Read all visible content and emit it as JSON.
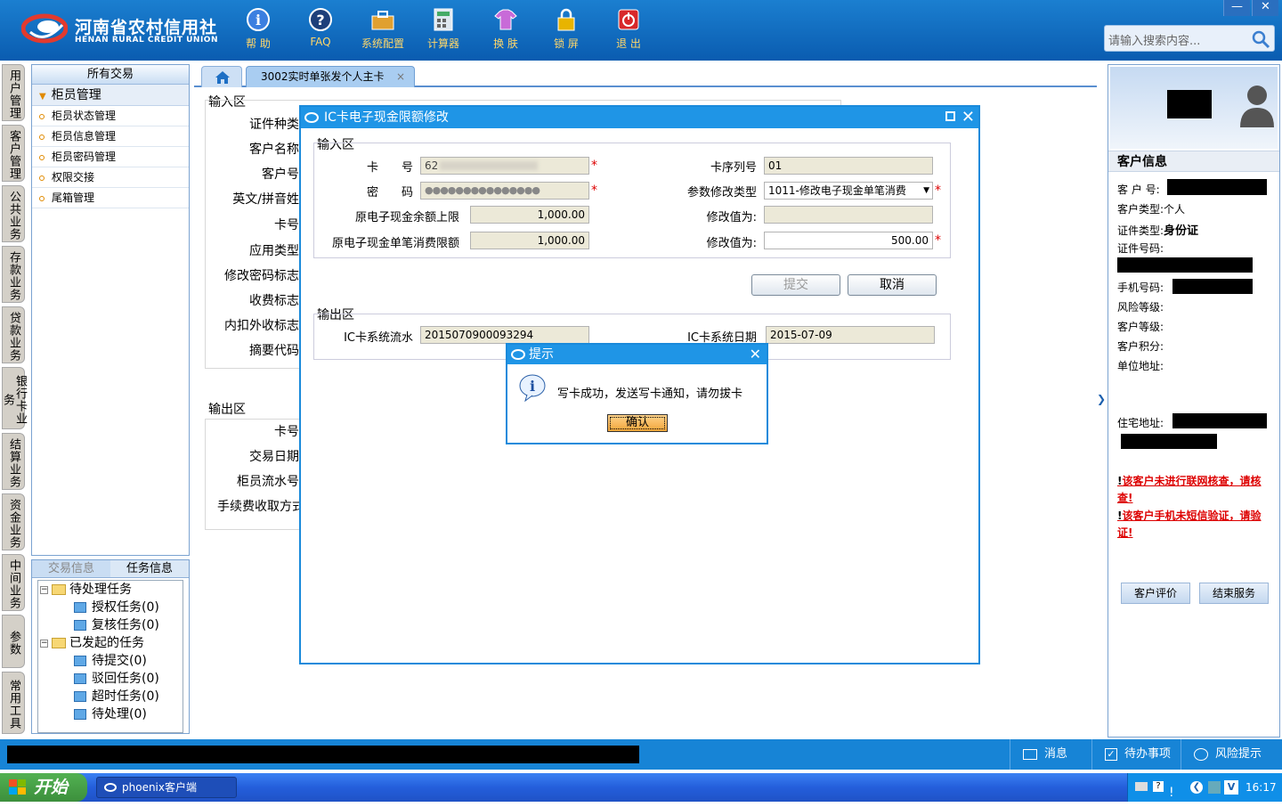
{
  "app": {
    "logo_cn": "河南省农村信用社",
    "logo_en": "HENAN RURAL CREDIT UNION",
    "toolbar": [
      {
        "label": "帮 助",
        "icon": "info-icon"
      },
      {
        "label": "FAQ",
        "icon": "question-icon"
      },
      {
        "label": "系统配置",
        "icon": "toolbox-icon"
      },
      {
        "label": "计算器",
        "icon": "calculator-icon"
      },
      {
        "label": "换 肤",
        "icon": "shirt-icon"
      },
      {
        "label": "锁 屏",
        "icon": "lock-icon"
      },
      {
        "label": "退 出",
        "icon": "power-icon"
      }
    ],
    "window_controls": {
      "minimize": "—",
      "close": "✕"
    },
    "search_placeholder": "请输入搜索内容..."
  },
  "left_tabs": [
    "用户管理",
    "客户管理",
    "公共业务",
    "存款业务",
    "贷款业务",
    "银行卡业务",
    "结算业务",
    "资金业务",
    "中间业务",
    "参数",
    "常用工具"
  ],
  "menu": {
    "header": "所有交易",
    "group": "柜员管理",
    "items": [
      "柜员状态管理",
      "柜员信息管理",
      "柜员密码管理",
      "权限交接",
      "尾箱管理"
    ]
  },
  "task_panel": {
    "tabs": [
      "交易信息",
      "任务信息"
    ],
    "tree": [
      {
        "label": "待处理任务",
        "children": [
          "授权任务(0)",
          "复核任务(0)"
        ]
      },
      {
        "label": "已发起的任务",
        "children": [
          "待提交(0)",
          "驳回任务(0)",
          "超时任务(0)",
          "待处理(0)"
        ]
      }
    ]
  },
  "tabs": {
    "doc_tab": "3002实时单张发个人主卡",
    "close": "×"
  },
  "background_form": {
    "input_section": "输入区",
    "input_labels": [
      "证件种类",
      "客户名称",
      "客户号",
      "英文/拼音姓",
      "卡号",
      "应用类型",
      "修改密码标志",
      "收费标志",
      "内扣外收标志",
      "摘要代码"
    ],
    "output_section": "输出区",
    "output_labels": [
      "卡号",
      "交易日期",
      "柜员流水号",
      "手续费收取方式"
    ]
  },
  "dialog": {
    "title": "IC卡电子现金限额修改",
    "input_section": "输入区",
    "fields": {
      "card_no_label": "卡　　号",
      "card_no_value": "62",
      "password_label": "密　　码",
      "password_value": "●●●●●●●●●●●●●●●",
      "balance_limit_label": "原电子现金余额上限",
      "balance_limit_value": "1,000.00",
      "single_limit_label": "原电子现金单笔消费限额",
      "single_limit_value": "1,000.00",
      "card_seq_label": "卡序列号",
      "card_seq_value": "01",
      "param_type_label": "参数修改类型",
      "param_type_value": "1011-修改电子现金单笔消费",
      "modify1_label": "修改值为:",
      "modify1_value": "",
      "modify2_label": "修改值为:",
      "modify2_value": "500.00"
    },
    "required_mark": "*",
    "submit": "提交",
    "cancel": "取消",
    "output_section": "输出区",
    "serial_label": "IC卡系统流水",
    "serial_value": "2015070900093294",
    "date_label": "IC卡系统日期",
    "date_value": "2015-07-09"
  },
  "alert": {
    "title": "提示",
    "message": "写卡成功，发送写卡通知，请勿拔卡",
    "ok": "确认"
  },
  "customer": {
    "title": "客户信息",
    "customer_no_label": "客 户 号:",
    "type_label": "客户类型:",
    "type_value": "个人",
    "id_type_label": "证件类型:",
    "id_type_value": "身份证",
    "id_no_label": "证件号码:",
    "phone_label": "手机号码:",
    "risk_label": "风险等级:",
    "level_label": "客户等级:",
    "points_label": "客户积分:",
    "company_addr_label": "单位地址:",
    "home_addr_label": "住宅地址:",
    "warning1": "该客户未进行联网核查，请核查!",
    "warning2": "该客户手机未短信验证，请验证!",
    "bang": "!",
    "eval_button": "客户评价",
    "end_button": "结束服务"
  },
  "statusbar": {
    "message": "消息",
    "todo": "待办事项",
    "risk": "风险提示"
  },
  "taskbar": {
    "start": "开始",
    "task": "phoenix客户端",
    "time": "16:17"
  },
  "colors": {
    "header_blue": "#0a5cb0",
    "dialog_blue": "#1f95e6",
    "warning_red": "#d00000"
  }
}
